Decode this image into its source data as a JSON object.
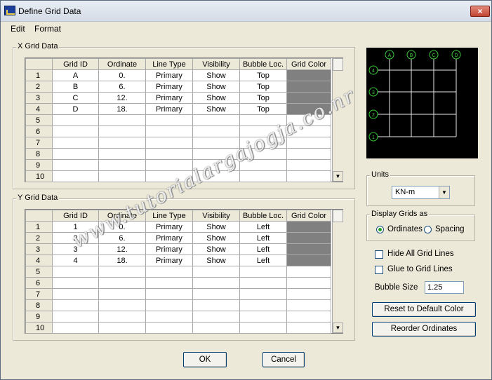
{
  "window": {
    "title": "Define Grid Data",
    "close_label": "×"
  },
  "menu": {
    "edit": "Edit",
    "format": "Format"
  },
  "x_grid": {
    "label": "X Grid Data",
    "headers": [
      "Grid ID",
      "Ordinate",
      "Line Type",
      "Visibility",
      "Bubble Loc.",
      "Grid Color"
    ],
    "rows": [
      {
        "num": "1",
        "id": "A",
        "ordinate": "0.",
        "line_type": "Primary",
        "visibility": "Show",
        "bubble": "Top"
      },
      {
        "num": "2",
        "id": "B",
        "ordinate": "6.",
        "line_type": "Primary",
        "visibility": "Show",
        "bubble": "Top"
      },
      {
        "num": "3",
        "id": "C",
        "ordinate": "12.",
        "line_type": "Primary",
        "visibility": "Show",
        "bubble": "Top"
      },
      {
        "num": "4",
        "id": "D",
        "ordinate": "18.",
        "line_type": "Primary",
        "visibility": "Show",
        "bubble": "Top"
      },
      {
        "num": "5"
      },
      {
        "num": "6"
      },
      {
        "num": "7"
      },
      {
        "num": "8"
      },
      {
        "num": "9"
      },
      {
        "num": "10"
      }
    ]
  },
  "y_grid": {
    "label": "Y Grid Data",
    "headers": [
      "Grid ID",
      "Ordinate",
      "Line Type",
      "Visibility",
      "Bubble Loc.",
      "Grid Color"
    ],
    "rows": [
      {
        "num": "1",
        "id": "1",
        "ordinate": "0.",
        "line_type": "Primary",
        "visibility": "Show",
        "bubble": "Left"
      },
      {
        "num": "2",
        "id": "2",
        "ordinate": "6.",
        "line_type": "Primary",
        "visibility": "Show",
        "bubble": "Left"
      },
      {
        "num": "3",
        "id": "3",
        "ordinate": "12.",
        "line_type": "Primary",
        "visibility": "Show",
        "bubble": "Left"
      },
      {
        "num": "4",
        "id": "4",
        "ordinate": "18.",
        "line_type": "Primary",
        "visibility": "Show",
        "bubble": "Left"
      },
      {
        "num": "5"
      },
      {
        "num": "6"
      },
      {
        "num": "7"
      },
      {
        "num": "8"
      },
      {
        "num": "9"
      },
      {
        "num": "10"
      }
    ]
  },
  "preview": {
    "x_bubbles": [
      "A",
      "B",
      "C",
      "D"
    ],
    "y_bubbles": [
      "4",
      "3",
      "2",
      "1"
    ],
    "grid_color": "#e8e8e8",
    "bubble_color": "#3cc83c"
  },
  "units": {
    "label": "Units",
    "value": "KN-m"
  },
  "display": {
    "label": "Display Grids as",
    "ordinates": "Ordinates",
    "spacing": "Spacing",
    "selected": "ordinates"
  },
  "options": {
    "hide_all": "Hide All Grid Lines",
    "glue": "Glue to Grid Lines",
    "bubble_size_label": "Bubble Size",
    "bubble_size_value": "1.25"
  },
  "buttons": {
    "reset_color": "Reset to Default Color",
    "reorder": "Reorder Ordinates",
    "ok": "OK",
    "cancel": "Cancel"
  },
  "watermark": "www.tutorialargajogja.co.nr",
  "colors": {
    "grid_color_cell": "#808080",
    "dialog_bg": "#ece9d8"
  }
}
